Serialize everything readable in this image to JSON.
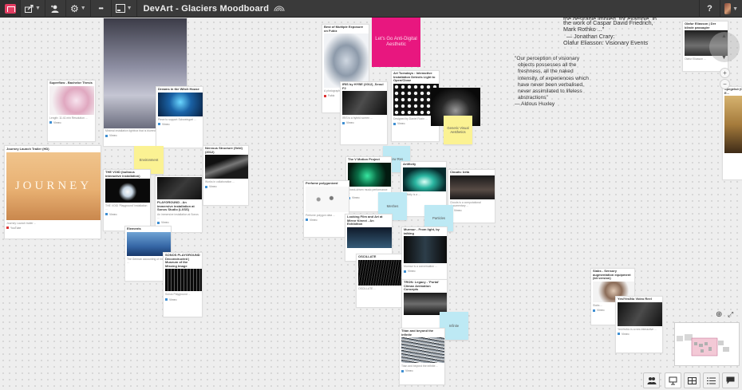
{
  "toolbar": {
    "title": "DevArt - Glaciers Moodboard",
    "help_label": "?",
    "more_label": "•••"
  },
  "icons": {
    "logo": "milanote-logo-icon",
    "share": "share-icon",
    "add_user": "add-user-icon",
    "settings": "gear-icon",
    "view": "view-mode-icon",
    "sync": "sync-icon",
    "help": "help-icon",
    "avatar": "avatar-icon"
  },
  "quotes": [
    {
      "text_lines": [
        "the desirable implied, for example, in",
        "the work of Caspar David Friedrich,",
        "Mark Rothko ...\""
      ],
      "author": "— Jonathan Crary:",
      "source": "Olafur Eliasson: Visionary Events"
    },
    {
      "text_lines": [
        "\"Our perception of visionary",
        "objects possesses all the",
        "freshness, all the naked",
        "intensity, of experiences which",
        "have never been verbalised,",
        "never assimilated to lifeless",
        "abstractions\""
      ],
      "author": "— Aldous Huxley"
    }
  ],
  "notes": [
    {
      "text": "Environment",
      "color": "yellow"
    },
    {
      "text": "Generic Visual Aesthetics",
      "color": "yellow"
    },
    {
      "text": "Low Res",
      "color": "blue"
    },
    {
      "text": "Meshes",
      "color": "blue"
    },
    {
      "text": "Particles",
      "color": "blue"
    },
    {
      "text": "Infinite",
      "color": "blue"
    }
  ],
  "cards": [
    {
      "title": "Superflow - Bachelor Thesis",
      "footer": "Vimeo"
    },
    {
      "title": "Dreams in the Witch House",
      "footer": "Vimeo"
    },
    {
      "title": "Journey Launch Trailer (HD)",
      "footer": "YouTube"
    },
    {
      "title": "JOURNEY",
      "footer": ""
    },
    {
      "title": "THE VOID (bulbous interactive installation)",
      "footer": "Vimeo"
    },
    {
      "title": "PLAYGROUND - An immersive installation at Sonos Studio (LXSS)",
      "footer": "Vimeo"
    },
    {
      "title": "Nervous Structure (field) (2012)",
      "footer": "Vimeo"
    },
    {
      "title": "Elements",
      "footer": ""
    },
    {
      "title": "SONOS PLAYGROUND Deconstructed | Museum of the Missing Image",
      "footer": "Vimeo"
    },
    {
      "title": "Best of Multiple Exposure on Fubiz",
      "footer": "Fubiz"
    },
    {
      "title": "IRIS by HYBE (2012)_Seoul F2",
      "footer": "Vimeo"
    },
    {
      "title": "Art Tuesdays : Interactive Installation Detects Light to Open/Close",
      "footer": "Vimeo"
    },
    {
      "title": "The V Motion Project",
      "footer": "Vimeo"
    },
    {
      "title": "Artificity",
      "footer": "Vimeo"
    },
    {
      "title": "Clouds: beta",
      "footer": "Vimeo"
    },
    {
      "title": "Perfume polygonized",
      "footer": "Vimeo"
    },
    {
      "title": "Looking Film and Art at Mirror Kinect - An Exhibition",
      "footer": "Vimeo"
    },
    {
      "title": "Murmur - From light, by talking",
      "footer": "Vimeo"
    },
    {
      "title": "OSCILLATE",
      "footer": "Vimeo"
    },
    {
      "title": "TRON: Legacy - 'Portal' Climax Animation Concepts",
      "footer": "Vimeo"
    },
    {
      "title": "Titan and beyond the infinite",
      "footer": "Vimeo"
    },
    {
      "title": "Olafur Eliasson | Der blinde passagier",
      "footer": ""
    },
    {
      "title": "Spegelsö (Olafur E...",
      "footer": ""
    },
    {
      "title": "Slabs - Sensory augmentation equipment (kit version)",
      "footer": "Vimeo"
    },
    {
      "title": "Yes/Yes/No Video Reel",
      "footer": "Vimeo"
    }
  ],
  "cards_labels": {
    "lets_go": "Let's Go Anti-Digital Aesthetic",
    "journey_word": "JOURNEY"
  },
  "colors": {
    "toolbar_bg": "#3a3a3a",
    "canvas_bg": "#eeeeee",
    "note_yellow": "#fbf293",
    "note_blue": "#bde9f4",
    "magenta": "#e8177f",
    "journey_sand": "#e8b072"
  },
  "controls": {
    "zoom_in": "+",
    "zoom_out": "−"
  }
}
